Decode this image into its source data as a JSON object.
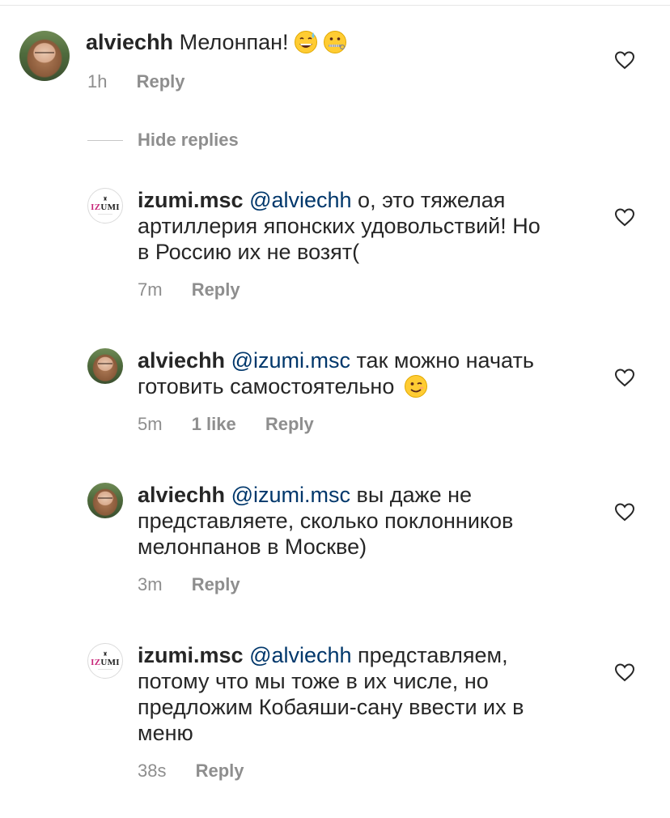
{
  "comments": [
    {
      "username": "alviechh",
      "mention": "",
      "text": "Мелонпан!",
      "emojis": [
        "grinning-sweat-emoji",
        "zipper-mouth-emoji"
      ],
      "time": "1h",
      "likes": "",
      "reply_label": "Reply",
      "avatar": "photo"
    },
    {
      "username": "izumi.msc",
      "mention": "@alviechh",
      "line1": " о, это тяжелая",
      "line2": "артиллерия японских удовольствий! Но",
      "line3": "в Россию их не возят(",
      "time": "7m",
      "likes": "",
      "reply_label": "Reply",
      "avatar": "logo"
    },
    {
      "username": "alviechh",
      "mention": "@izumi.msc",
      "line1": " так можно начать",
      "line2": "готовить самостоятельно",
      "emojis": [
        "winking-face-emoji"
      ],
      "time": "5m",
      "likes": "1 like",
      "reply_label": "Reply",
      "avatar": "photo"
    },
    {
      "username": "alviechh",
      "mention": "@izumi.msc",
      "line1": " вы даже не",
      "line2": "представляете, сколько поклонников",
      "line3": "мелонпанов в Москве)",
      "time": "3m",
      "likes": "",
      "reply_label": "Reply",
      "avatar": "photo"
    },
    {
      "username": "izumi.msc",
      "mention": "@alviechh",
      "line1": " представляем,",
      "line2": "потому что мы тоже в их числе, но",
      "line3": "предложим Кобаяши-сану ввести их в",
      "line4": "меню",
      "time": "38s",
      "likes": "",
      "reply_label": "Reply",
      "avatar": "logo"
    }
  ],
  "replies_toggle": {
    "label": "Hide replies"
  },
  "logo": {
    "text_pink": "IZ",
    "text_dark": "UMI"
  },
  "colors": {
    "text": "#262626",
    "secondary": "#8e8e8e",
    "mention": "#00376b",
    "divider": "#e6e6e6"
  }
}
